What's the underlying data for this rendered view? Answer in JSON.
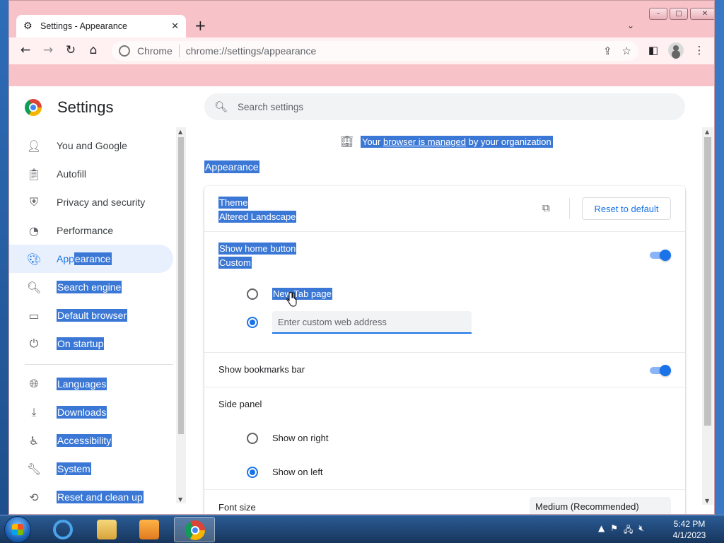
{
  "browser": {
    "tab_title": "Settings - Appearance",
    "new_tab_symbol": "+",
    "omnibox_origin": "Chrome",
    "omnibox_url": "chrome://settings/appearance"
  },
  "settings": {
    "title": "Settings",
    "search_placeholder": "Search settings",
    "nav": [
      {
        "label": "You and Google",
        "icon": "person-icon"
      },
      {
        "label": "Autofill",
        "icon": "clipboard-icon"
      },
      {
        "label": "Privacy and security",
        "icon": "shield-icon"
      },
      {
        "label": "Performance",
        "icon": "speedometer-icon"
      },
      {
        "label_plain": "App",
        "label_selected": "earance",
        "icon": "palette-icon"
      },
      {
        "label": "Search engine",
        "icon": "search-icon"
      },
      {
        "label": "Default browser",
        "icon": "browser-window-icon"
      },
      {
        "label": "On startup",
        "icon": "power-icon"
      },
      {
        "label": "Languages",
        "icon": "globe-icon"
      },
      {
        "label": "Downloads",
        "icon": "download-icon"
      },
      {
        "label": "Accessibility",
        "icon": "accessibility-icon"
      },
      {
        "label": "System",
        "icon": "wrench-icon"
      },
      {
        "label": "Reset and clean up",
        "icon": "history-icon"
      }
    ],
    "managed_prefix": "Your ",
    "managed_link": "browser is managed",
    "managed_suffix": " by your organization",
    "section_title": "Appearance",
    "theme": {
      "label": "Theme",
      "value": "Altered Landscape",
      "reset_label": "Reset to default"
    },
    "home_button": {
      "label": "Show home button",
      "sublabel": "Custom",
      "enabled": true
    },
    "home_options": {
      "new_tab_label": "New Tab page",
      "custom_placeholder": "Enter custom web address",
      "selected": "custom"
    },
    "bookmarks_bar": {
      "label": "Show bookmarks bar",
      "enabled": true
    },
    "side_panel": {
      "label": "Side panel",
      "options": [
        "Show on right",
        "Show on left"
      ],
      "selected": "Show on left"
    },
    "font_size": {
      "label": "Font size",
      "value": "Medium (Recommended)"
    }
  },
  "taskbar": {
    "time": "5:42 PM",
    "date": "4/1/2023"
  },
  "colors": {
    "accent": "#1a73e8",
    "selection": "#3b78d6",
    "titlebar": "#f7c3c9"
  }
}
